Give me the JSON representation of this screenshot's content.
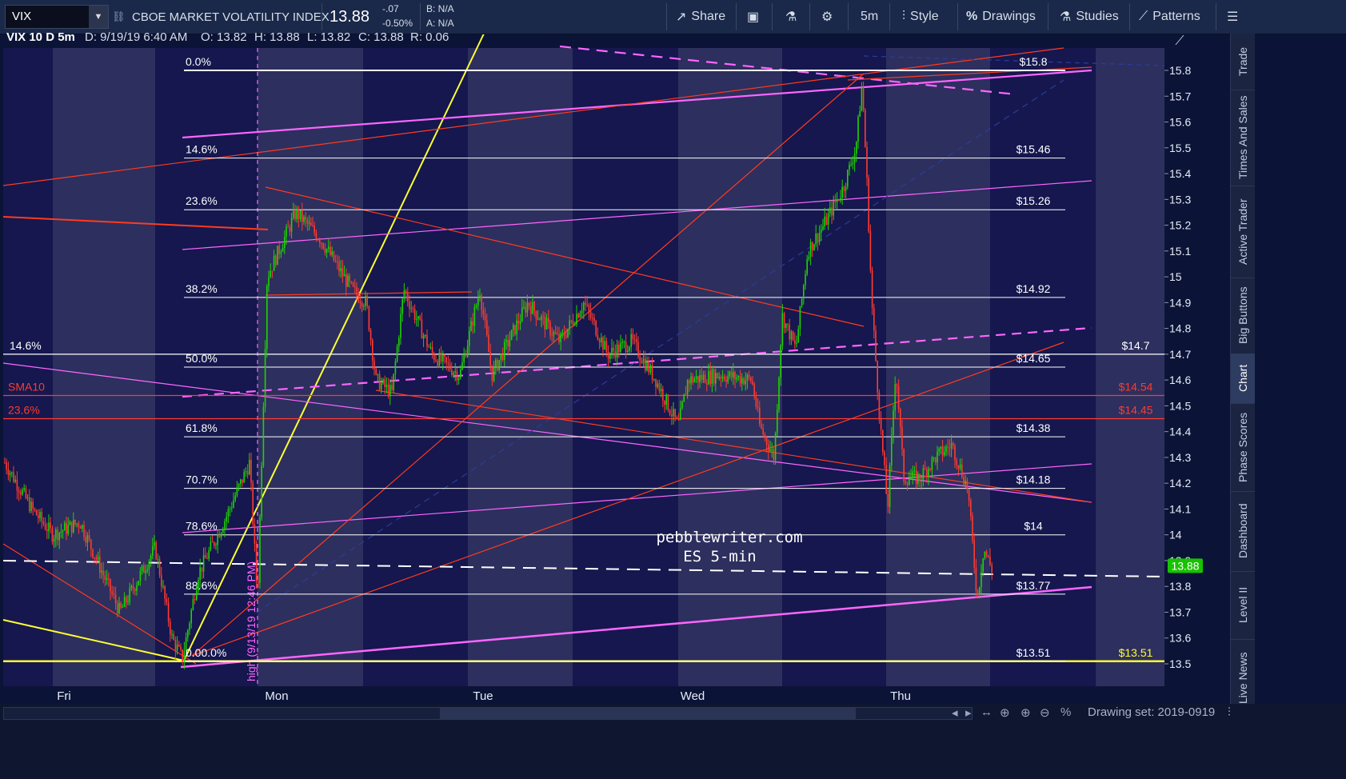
{
  "toolbar": {
    "symbol": "VIX",
    "symbol_desc": "CBOE MARKET VOLATILITY INDEX",
    "last_price": "13.88",
    "net_change": "-.07",
    "pct_change": "-0.50%",
    "bid": "B: N/A",
    "ask": "A: N/A",
    "share_label": "Share",
    "interval_label": "5m",
    "style_label": "Style",
    "drawings_label": "Drawings",
    "studies_label": "Studies",
    "patterns_label": "Patterns"
  },
  "infobar": {
    "title": "VIX 10 D 5m",
    "date": "D: 9/19/19 6:40 AM",
    "open": "O: 13.82",
    "high": "H: 13.88",
    "low": "L: 13.82",
    "close": "C: 13.88",
    "range": "R: 0.06"
  },
  "right_panel": {
    "tabs": [
      "Trade",
      "Times And Sales",
      "Active Trader",
      "Big Buttons",
      "Chart",
      "Phase Scores",
      "Dashboard",
      "Level II",
      "Live News"
    ],
    "active": "Chart"
  },
  "bottombar": {
    "drawing_set": "Drawing set: 2019-0919"
  },
  "chart_data": {
    "type": "candlestick",
    "symbol": "VIX",
    "interval": "5m",
    "ylim": [
      13.42,
      15.92
    ],
    "y_ticks": [
      13.5,
      13.6,
      13.7,
      13.8,
      13.9,
      14,
      14.1,
      14.2,
      14.3,
      14.4,
      14.5,
      14.6,
      14.7,
      14.8,
      14.9,
      15,
      15.1,
      15.2,
      15.3,
      15.4,
      15.5,
      15.6,
      15.7,
      15.8
    ],
    "y_tick_labels": [
      "13.5",
      "13.6",
      "13.7",
      "13.8",
      "13.9",
      "14",
      "14.1",
      "14.2",
      "14.3",
      "14.4",
      "14.5",
      "14.6",
      "14.7",
      "14.8",
      "14.9",
      "15",
      "15.1",
      "15.2",
      "15.3",
      "15.4",
      "15.5",
      "15.6",
      "15.7",
      "15.8"
    ],
    "x_labels": [
      "Fri",
      "Mon",
      "Tue",
      "Wed",
      "Thu"
    ],
    "last_price": 13.88,
    "last_price_label": "13.88",
    "watermark": [
      "pebblewriter.com",
      "ES 5-min"
    ],
    "vertical_marker_label": "high (9/13/19 12:46 PM)",
    "fib_levels": [
      {
        "pct": "0.0%",
        "price": 15.8,
        "label": "$15.8"
      },
      {
        "pct": "14.6%",
        "price": 15.46,
        "label": "$15.46"
      },
      {
        "pct": "23.6%",
        "price": 15.26,
        "label": "$15.26"
      },
      {
        "pct": "38.2%",
        "price": 14.92,
        "label": "$14.92"
      },
      {
        "pct": "50.0%",
        "price": 14.65,
        "label": "$14.65"
      },
      {
        "pct": "61.8%",
        "price": 14.38,
        "label": "$14.38"
      },
      {
        "pct": "70.7%",
        "price": 14.18,
        "label": "$14.18"
      },
      {
        "pct": "78.6%",
        "price": 14.0,
        "label": "$14"
      },
      {
        "pct": "88.6%",
        "price": 13.77,
        "label": "$13.77"
      },
      {
        "pct": "0.00.0%",
        "price": 13.51,
        "label": "$13.51"
      }
    ],
    "outer_levels": [
      {
        "label": "14.6%",
        "price": 14.7,
        "value_label": "$14.7",
        "color": "#ffffff"
      },
      {
        "label": "SMA10",
        "price": 14.54,
        "value_label": "$14.54",
        "color": "#ff3b2f"
      },
      {
        "label": "23.6%",
        "price": 14.45,
        "value_label": "$14.45",
        "color": "#ff3b2f"
      },
      {
        "label": "",
        "price": 13.51,
        "value_label": "$13.51",
        "color": "#ffff33"
      }
    ],
    "colors": {
      "up": "#1ed400",
      "down": "#ff3b2f",
      "fib": "#ffffff",
      "trend_pink": "#ff66ff",
      "trend_yellow": "#ffff33",
      "trend_red": "#ff3b1f"
    }
  }
}
